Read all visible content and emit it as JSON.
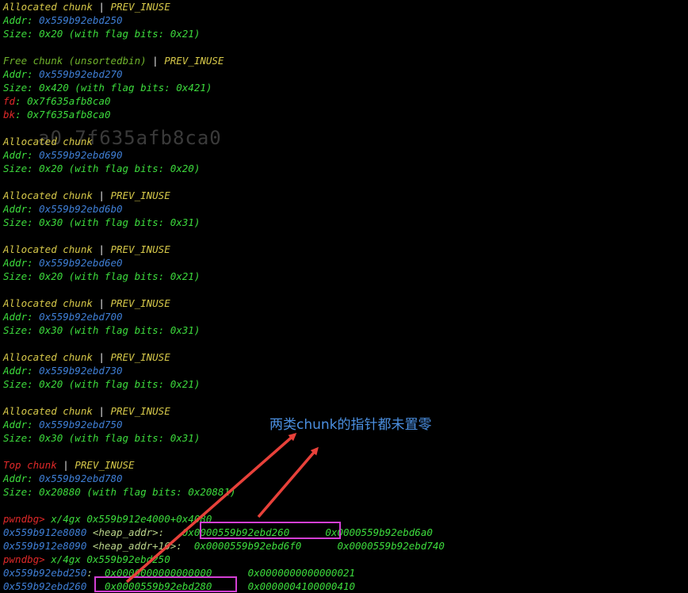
{
  "faded_text": "a0 7f635afb8ca0",
  "annotation": "两类chunk的指针都未置零",
  "colors": {
    "annotation": "#4b8fe0",
    "highlight_box": "#d43fd4",
    "arrow": "#e8413a"
  },
  "chunks": [
    {
      "header_a": "Allocated chunk",
      "sep": " | ",
      "header_b": "PREV_INUSE",
      "addr_label": "Addr: ",
      "addr": "0x559b92ebd250",
      "size_text": "Size: 0x20 (with flag bits: 0x21)"
    },
    {
      "header_a": "Free chunk (unsortedbin)",
      "sep": " | ",
      "header_b": "PREV_INUSE",
      "addr_label": "Addr: ",
      "addr": "0x559b92ebd270",
      "size_text": "Size: 0x420 (with flag bits: 0x421)",
      "fd_label": "fd",
      "fd": ": 0x7f635afb8ca0",
      "bk_label": "bk",
      "bk": ": 0x7f635afb8ca0"
    },
    {
      "header_a": "Allocated chunk",
      "addr_label": "Addr: ",
      "addr": "0x559b92ebd690",
      "size_text": "Size: 0x20 (with flag bits: 0x20)"
    },
    {
      "header_a": "Allocated chunk",
      "sep": " | ",
      "header_b": "PREV_INUSE",
      "addr_label": "Addr: ",
      "addr": "0x559b92ebd6b0",
      "size_text": "Size: 0x30 (with flag bits: 0x31)"
    },
    {
      "header_a": "Allocated chunk",
      "sep": " | ",
      "header_b": "PREV_INUSE",
      "addr_label": "Addr: ",
      "addr": "0x559b92ebd6e0",
      "size_text": "Size: 0x20 (with flag bits: 0x21)"
    },
    {
      "header_a": "Allocated chunk",
      "sep": " | ",
      "header_b": "PREV_INUSE",
      "addr_label": "Addr: ",
      "addr": "0x559b92ebd700",
      "size_text": "Size: 0x30 (with flag bits: 0x31)"
    },
    {
      "header_a": "Allocated chunk",
      "sep": " | ",
      "header_b": "PREV_INUSE",
      "addr_label": "Addr: ",
      "addr": "0x559b92ebd730",
      "size_text": "Size: 0x20 (with flag bits: 0x21)"
    },
    {
      "header_a": "Allocated chunk",
      "sep": " | ",
      "header_b": "PREV_INUSE",
      "addr_label": "Addr: ",
      "addr": "0x559b92ebd750",
      "size_text": "Size: 0x30 (with flag bits: 0x31)"
    },
    {
      "header_a": "Top chunk",
      "sep": " | ",
      "header_b": "PREV_INUSE",
      "addr_label": "Addr: ",
      "addr": "0x559b92ebd780",
      "size_text": "Size: 0x20880 (with flag bits: 0x20881)"
    }
  ],
  "commands": [
    {
      "prompt": "pwndbg>",
      "command": " x/4gx 0x559b912e4000+0x4080",
      "rows": [
        {
          "addr": "0x559b912e8080",
          "sym": " <heap_addr>:   ",
          "v1": "0x0000559b92ebd260",
          "gap": "      ",
          "v2": "0x0000559b92ebd6a0"
        },
        {
          "addr": "0x559b912e8090",
          "sym": " <heap_addr+16>:  ",
          "v1": "0x0000559b92ebd6f0",
          "gap": "      ",
          "v2": "0x0000559b92ebd740"
        }
      ]
    },
    {
      "prompt": "pwndbg>",
      "command": " x/4gx 0x559b92ebd250",
      "rows": [
        {
          "addr": "0x559b92ebd250",
          "sym": ":  ",
          "v1": "0x0000000000000000",
          "gap": "      ",
          "v2": "0x0000000000000021"
        },
        {
          "addr": "0x559b92ebd260",
          "sym": "   ",
          "v1": "0x0000559b92ebd280",
          "gap": "      ",
          "v2": "0x0000004100000410"
        }
      ]
    }
  ]
}
